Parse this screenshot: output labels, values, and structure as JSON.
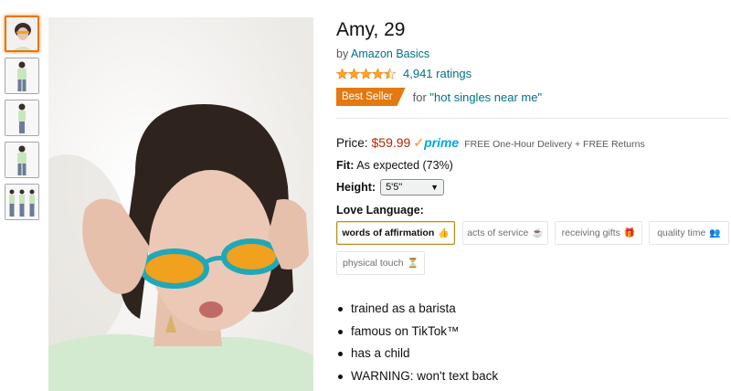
{
  "product": {
    "title": "Amy, 29",
    "by_prefix": "by ",
    "brand": "Amazon Basics",
    "star_rating": 4.5,
    "ratings_count": "4,941 ratings",
    "badge": "Best Seller",
    "badge_for_prefix": "for ",
    "badge_category": "\"hot singles near me\"",
    "price_label": "Price:",
    "price": "$59.99",
    "prime_check": "✓",
    "prime_word": "prime",
    "delivery": "FREE One-Hour Delivery + FREE Returns",
    "fit_label": "Fit:",
    "fit_value": "As expected (73%)",
    "height_label": "Height:",
    "height_value": "5'5\"",
    "love_label": "Love Language:",
    "love_options": [
      {
        "label": "words of affirmation",
        "emoji": "👍",
        "selected": true
      },
      {
        "label": "acts of service",
        "emoji": "☕",
        "selected": false
      },
      {
        "label": "receiving gifts",
        "emoji": "🎁",
        "selected": false
      },
      {
        "label": "quality time",
        "emoji": "👥",
        "selected": false
      },
      {
        "label": "physical touch",
        "emoji": "⏳",
        "selected": false
      }
    ],
    "bullets": [
      "trained as a barista",
      "famous on TikTok™",
      "has a child",
      "WARNING: won't text back"
    ]
  },
  "colors": {
    "link": "#007185",
    "price": "#b12704",
    "badge": "#e47911",
    "star": "#ffa41c",
    "prime": "#00a8e1",
    "selected_border": "#b58d17"
  },
  "thumbnails": [
    "thumb-portrait",
    "thumb-full-front",
    "thumb-full-side",
    "thumb-full-back",
    "thumb-group"
  ]
}
